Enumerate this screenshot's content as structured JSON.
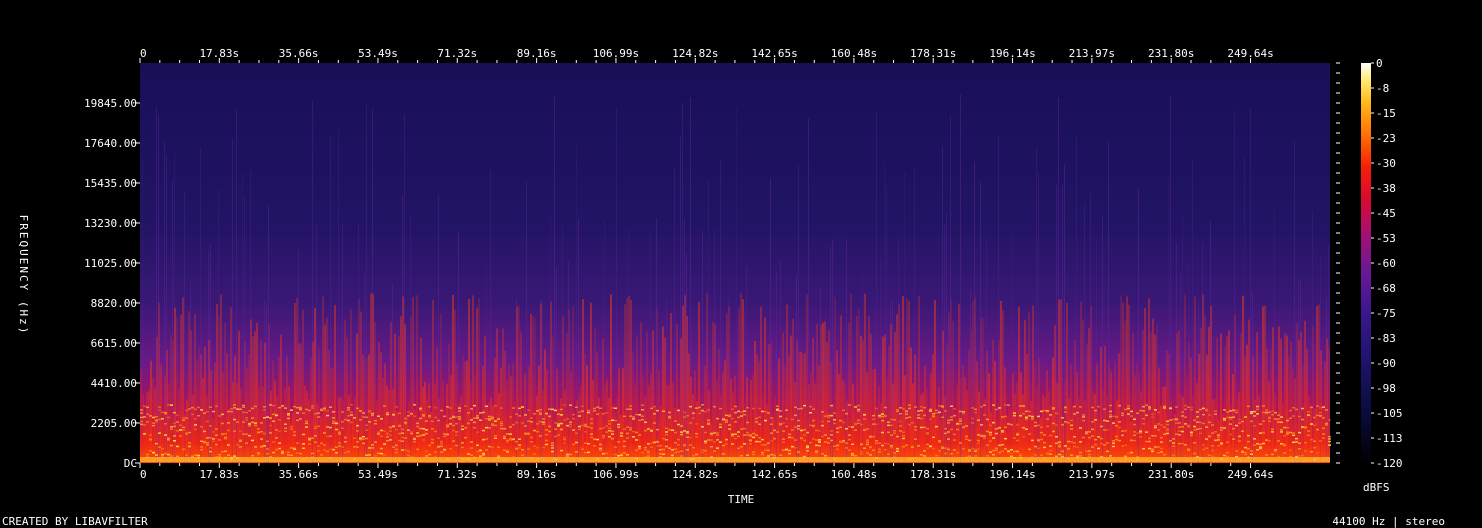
{
  "chart_data": {
    "type": "heatmap",
    "title": "",
    "xlabel": "TIME",
    "ylabel": "FREQUENCY (Hz)",
    "x_tick_labels": [
      "0",
      "17.83s",
      "35.66s",
      "53.49s",
      "71.32s",
      "89.16s",
      "106.99s",
      "124.82s",
      "142.65s",
      "160.48s",
      "178.31s",
      "196.14s",
      "213.97s",
      "231.80s",
      "249.64s"
    ],
    "x_tick_values": [
      0,
      17.83,
      35.66,
      53.49,
      71.32,
      89.16,
      106.99,
      124.82,
      142.65,
      160.48,
      178.31,
      196.14,
      213.97,
      231.8,
      249.64
    ],
    "xlim": [
      0,
      267.5
    ],
    "y_tick_labels": [
      "DC",
      "2205.00",
      "4410.00",
      "6615.00",
      "8820.00",
      "11025.00",
      "13230.00",
      "15435.00",
      "17640.00",
      "19845.00"
    ],
    "y_tick_values": [
      0,
      2205,
      4410,
      6615,
      8820,
      11025,
      13230,
      15435,
      17640,
      19845
    ],
    "ylim": [
      0,
      22050
    ],
    "colorbar": {
      "label": "dBFS",
      "tick_labels": [
        "0",
        "-8",
        "-15",
        "-23",
        "-30",
        "-38",
        "-45",
        "-53",
        "-60",
        "-68",
        "-75",
        "-83",
        "-90",
        "-98",
        "-105",
        "-113",
        "-120"
      ],
      "range": [
        -120,
        0
      ]
    },
    "grid": false
  },
  "footer": {
    "left": "CREATED BY LIBAVFILTER",
    "right": "44100 Hz | stereo"
  }
}
